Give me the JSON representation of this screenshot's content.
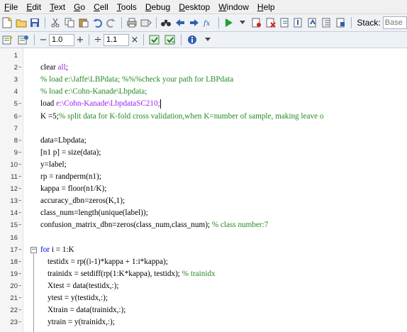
{
  "menu": [
    "File",
    "Edit",
    "Text",
    "Go",
    "Cell",
    "Tools",
    "Debug",
    "Desktop",
    "Window",
    "Help"
  ],
  "toolbar": {
    "stack_label": "Stack:",
    "stack_value": "Base"
  },
  "cell_toolbar": {
    "minus": "−",
    "value1": "1.0",
    "plus": "+",
    "divide": "÷",
    "value2": "1.1",
    "times": "×"
  },
  "editor": {
    "lines": [
      {
        "n": "1",
        "dash": "",
        "parts": []
      },
      {
        "n": "2",
        "dash": "–",
        "parts": [
          {
            "t": "clear ",
            "c": ""
          },
          {
            "t": "all",
            "c": "str"
          },
          {
            "t": ";",
            "c": ""
          }
        ]
      },
      {
        "n": "3",
        "dash": "",
        "parts": [
          {
            "t": "% load e:\\Jaffe\\LBPdata; %%%check your path for LBPdata",
            "c": "cm"
          }
        ]
      },
      {
        "n": "4",
        "dash": "",
        "parts": [
          {
            "t": "% load e:\\Cohn-Kanade\\Lbpdata;",
            "c": "cm"
          }
        ]
      },
      {
        "n": "5",
        "dash": "–",
        "parts": [
          {
            "t": "load ",
            "c": ""
          },
          {
            "t": "e:\\Cohn-Kanade\\LbpdataSC210;",
            "c": "str"
          }
        ],
        "cursor": true
      },
      {
        "n": "6",
        "dash": "–",
        "parts": [
          {
            "t": "K =5;",
            "c": ""
          },
          {
            "t": "% split data for K-fold cross validation,when K=number of sample, making leave o",
            "c": "cm"
          }
        ]
      },
      {
        "n": "7",
        "dash": "",
        "parts": []
      },
      {
        "n": "8",
        "dash": "–",
        "parts": [
          {
            "t": "data=Lbpdata;",
            "c": ""
          }
        ]
      },
      {
        "n": "9",
        "dash": "–",
        "parts": [
          {
            "t": "[n1 p] = size(data);",
            "c": ""
          }
        ]
      },
      {
        "n": "10",
        "dash": "–",
        "parts": [
          {
            "t": "y=label;",
            "c": ""
          }
        ]
      },
      {
        "n": "11",
        "dash": "–",
        "parts": [
          {
            "t": "rp = randperm(n1);",
            "c": ""
          }
        ]
      },
      {
        "n": "12",
        "dash": "–",
        "parts": [
          {
            "t": "kappa = floor(n1/K);",
            "c": ""
          }
        ]
      },
      {
        "n": "13",
        "dash": "–",
        "parts": [
          {
            "t": "accuracy_dbn=zeros(K,1);",
            "c": ""
          }
        ]
      },
      {
        "n": "14",
        "dash": "–",
        "parts": [
          {
            "t": "class_num=length(unique(label));",
            "c": ""
          }
        ]
      },
      {
        "n": "15",
        "dash": "–",
        "parts": [
          {
            "t": "confusion_matrix_dbn=zeros(class_num,class_num); ",
            "c": ""
          },
          {
            "t": "% class number:7",
            "c": "cm"
          }
        ]
      },
      {
        "n": "16",
        "dash": "",
        "parts": []
      },
      {
        "n": "17",
        "dash": "–",
        "fold": true,
        "parts": [
          {
            "t": "for",
            "c": "kw"
          },
          {
            "t": " i = 1:K",
            "c": ""
          }
        ]
      },
      {
        "n": "18",
        "dash": "–",
        "indent": true,
        "parts": [
          {
            "t": "testidx = rp((i-1)*kappa + 1:i*kappa);",
            "c": ""
          }
        ]
      },
      {
        "n": "19",
        "dash": "–",
        "indent": true,
        "parts": [
          {
            "t": "trainidx = setdiff(rp(1:K*kappa), testidx); ",
            "c": ""
          },
          {
            "t": "% trainidx",
            "c": "cm"
          }
        ]
      },
      {
        "n": "20",
        "dash": "–",
        "indent": true,
        "parts": [
          {
            "t": "Xtest = data(testidx,:);",
            "c": ""
          }
        ]
      },
      {
        "n": "21",
        "dash": "–",
        "indent": true,
        "parts": [
          {
            "t": "ytest = y(testidx,:);",
            "c": ""
          }
        ]
      },
      {
        "n": "22",
        "dash": "–",
        "indent": true,
        "parts": [
          {
            "t": "Xtrain = data(trainidx,:);",
            "c": ""
          }
        ]
      },
      {
        "n": "23",
        "dash": "–",
        "indent": true,
        "parts": [
          {
            "t": "ytrain = y(trainidx,:);",
            "c": ""
          }
        ]
      }
    ]
  }
}
